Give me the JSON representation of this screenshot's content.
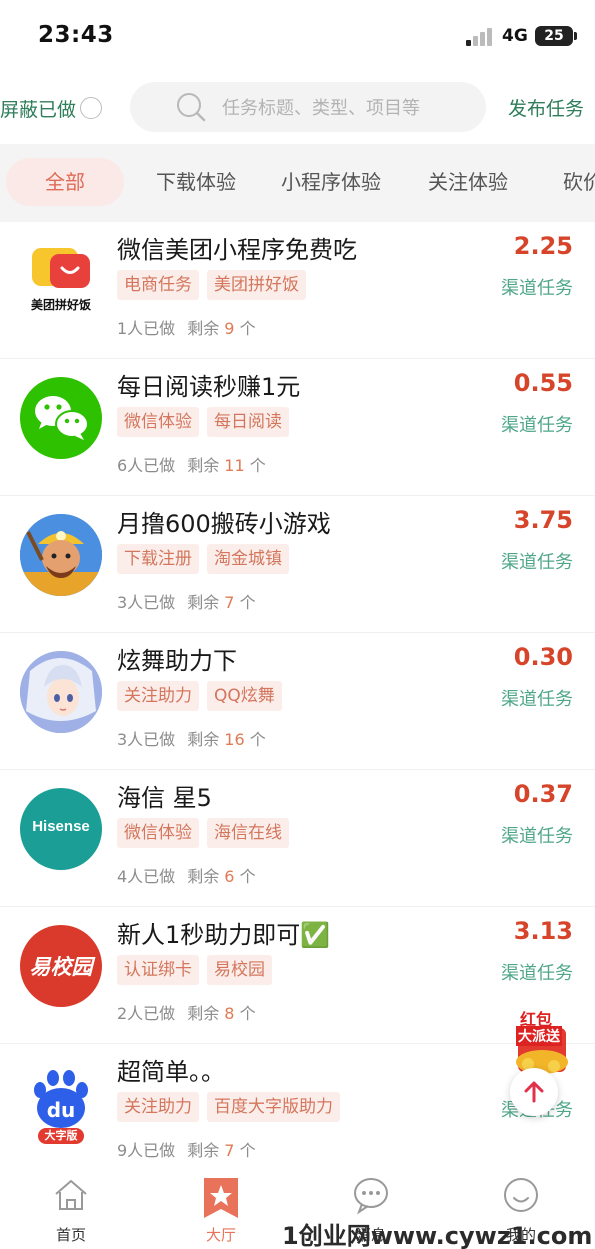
{
  "status_bar": {
    "time": "23:43",
    "network": "4G",
    "battery": "25"
  },
  "search_row": {
    "hide_done_label": "屏蔽已做",
    "search_placeholder": "任务标题、类型、项目等",
    "publish_label": "发布任务"
  },
  "tabs": [
    {
      "label": "全部",
      "active": true
    },
    {
      "label": "下载体验",
      "active": false
    },
    {
      "label": "小程序体验",
      "active": false
    },
    {
      "label": "关注体验",
      "active": false
    },
    {
      "label": "砍价",
      "active": false
    }
  ],
  "tasks": [
    {
      "title": "微信美团小程序免费吃",
      "tags": [
        "电商任务",
        "美团拼好饭"
      ],
      "done_text": "1人已做",
      "remain_prefix": "剩余",
      "remain_num": "9",
      "remain_suffix": "个",
      "price": "2.25",
      "channel": "渠道任务",
      "icon": "meituan-pinhaofan-icon",
      "icon_text": "美团拼好饭"
    },
    {
      "title": "每日阅读秒赚1元",
      "tags": [
        "微信体验",
        "每日阅读"
      ],
      "done_text": "6人已做",
      "remain_prefix": "剩余",
      "remain_num": "11",
      "remain_suffix": "个",
      "price": "0.55",
      "channel": "渠道任务",
      "icon": "wechat-icon"
    },
    {
      "title": "月撸600搬砖小游戏",
      "tags": [
        "下载注册",
        "淘金城镇"
      ],
      "done_text": "3人已做",
      "remain_prefix": "剩余",
      "remain_num": "7",
      "remain_suffix": "个",
      "price": "3.75",
      "channel": "渠道任务",
      "icon": "miner-game-icon"
    },
    {
      "title": "炫舞助力下",
      "tags": [
        "关注助力",
        "QQ炫舞"
      ],
      "done_text": "3人已做",
      "remain_prefix": "剩余",
      "remain_num": "16",
      "remain_suffix": "个",
      "price": "0.30",
      "channel": "渠道任务",
      "icon": "qq-dance-icon"
    },
    {
      "title": "海信 星5",
      "tags": [
        "微信体验",
        "海信在线"
      ],
      "done_text": "4人已做",
      "remain_prefix": "剩余",
      "remain_num": "6",
      "remain_suffix": "个",
      "price": "0.37",
      "channel": "渠道任务",
      "icon": "hisense-icon",
      "icon_text": "Hisense"
    },
    {
      "title": "新人1秒助力即可✅",
      "tags": [
        "认证绑卡",
        "易校园"
      ],
      "done_text": "2人已做",
      "remain_prefix": "剩余",
      "remain_num": "8",
      "remain_suffix": "个",
      "price": "3.13",
      "channel": "渠道任务",
      "icon": "yixiaoyuan-icon",
      "icon_text": "易校园"
    },
    {
      "title": "超简单。。",
      "tags": [
        "关注助力",
        "百度大字版助力"
      ],
      "done_text": "9人已做",
      "remain_prefix": "剩余",
      "remain_num": "7",
      "remain_suffix": "个",
      "price": "",
      "channel": "渠道任务",
      "icon": "baidu-du-icon",
      "icon_text": "du",
      "icon_sub": "大字版"
    }
  ],
  "float_packet": {
    "line1": "红包",
    "line2": "大派送"
  },
  "bottom_nav": [
    {
      "label": "首页",
      "icon": "home-icon"
    },
    {
      "label": "大厅",
      "icon": "hall-star-icon"
    },
    {
      "label": "消息",
      "icon": "message-icon"
    },
    {
      "label": "我的",
      "icon": "profile-icon"
    }
  ],
  "watermark": "1创业网www.cywz1.com",
  "colors": {
    "accent_red": "#d6442a",
    "channel_green": "#4fa68a",
    "tag_bg": "#fbeeea",
    "tag_text": "#d4765d",
    "nav_active": "#e8735a"
  }
}
